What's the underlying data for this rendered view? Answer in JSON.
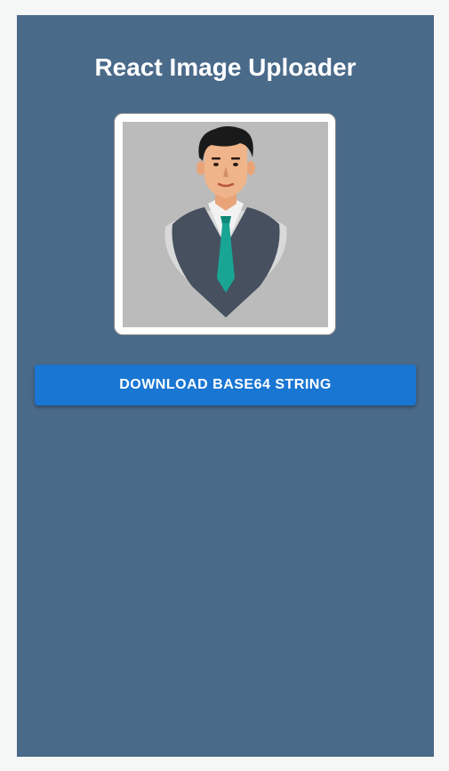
{
  "app": {
    "title": "React Image Uploader"
  },
  "preview": {
    "icon": "businessman-avatar",
    "alt": ""
  },
  "actions": {
    "download_label": "DOWNLOAD BASE64 STRING"
  },
  "colors": {
    "page_background": "#f5f6f6",
    "panel_background": "#4a6a8a",
    "button_background": "#1976d2",
    "button_text": "#ffffff",
    "title_text": "#ffffff"
  }
}
